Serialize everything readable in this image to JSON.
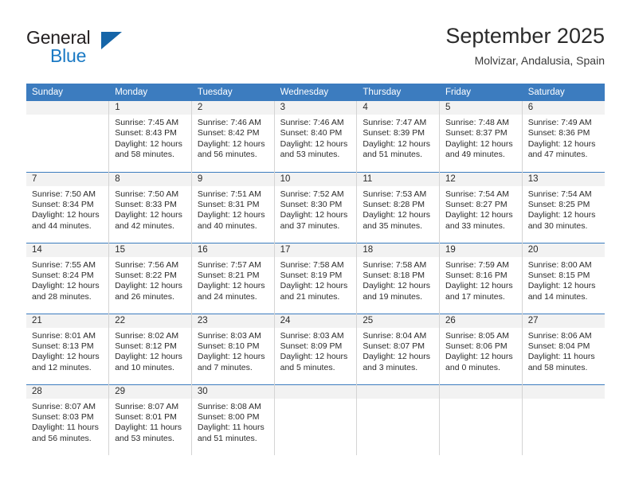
{
  "brand": {
    "name_part1": "General",
    "name_part2": "Blue",
    "logo_icon": "blue-triangle-icon",
    "accent_color": "#1b7ac4"
  },
  "header": {
    "title": "September 2025",
    "subtitle": "Molvizar, Andalusia, Spain"
  },
  "theme": {
    "header_row_color": "#3c7cbf",
    "daynum_band_color": "#f2f2f2",
    "grid_line_color": "#d4d4d4"
  },
  "weekday_headers": [
    "Sunday",
    "Monday",
    "Tuesday",
    "Wednesday",
    "Thursday",
    "Friday",
    "Saturday"
  ],
  "labels": {
    "sunrise_prefix": "Sunrise:",
    "sunset_prefix": "Sunset:",
    "daylight_prefix": "Daylight:"
  },
  "weeks": [
    [
      {
        "day": "",
        "sunrise": "",
        "sunset": "",
        "daylight_line1": "",
        "daylight_line2": ""
      },
      {
        "day": "1",
        "sunrise": "Sunrise: 7:45 AM",
        "sunset": "Sunset: 8:43 PM",
        "daylight_line1": "Daylight: 12 hours",
        "daylight_line2": "and 58 minutes."
      },
      {
        "day": "2",
        "sunrise": "Sunrise: 7:46 AM",
        "sunset": "Sunset: 8:42 PM",
        "daylight_line1": "Daylight: 12 hours",
        "daylight_line2": "and 56 minutes."
      },
      {
        "day": "3",
        "sunrise": "Sunrise: 7:46 AM",
        "sunset": "Sunset: 8:40 PM",
        "daylight_line1": "Daylight: 12 hours",
        "daylight_line2": "and 53 minutes."
      },
      {
        "day": "4",
        "sunrise": "Sunrise: 7:47 AM",
        "sunset": "Sunset: 8:39 PM",
        "daylight_line1": "Daylight: 12 hours",
        "daylight_line2": "and 51 minutes."
      },
      {
        "day": "5",
        "sunrise": "Sunrise: 7:48 AM",
        "sunset": "Sunset: 8:37 PM",
        "daylight_line1": "Daylight: 12 hours",
        "daylight_line2": "and 49 minutes."
      },
      {
        "day": "6",
        "sunrise": "Sunrise: 7:49 AM",
        "sunset": "Sunset: 8:36 PM",
        "daylight_line1": "Daylight: 12 hours",
        "daylight_line2": "and 47 minutes."
      }
    ],
    [
      {
        "day": "7",
        "sunrise": "Sunrise: 7:50 AM",
        "sunset": "Sunset: 8:34 PM",
        "daylight_line1": "Daylight: 12 hours",
        "daylight_line2": "and 44 minutes."
      },
      {
        "day": "8",
        "sunrise": "Sunrise: 7:50 AM",
        "sunset": "Sunset: 8:33 PM",
        "daylight_line1": "Daylight: 12 hours",
        "daylight_line2": "and 42 minutes."
      },
      {
        "day": "9",
        "sunrise": "Sunrise: 7:51 AM",
        "sunset": "Sunset: 8:31 PM",
        "daylight_line1": "Daylight: 12 hours",
        "daylight_line2": "and 40 minutes."
      },
      {
        "day": "10",
        "sunrise": "Sunrise: 7:52 AM",
        "sunset": "Sunset: 8:30 PM",
        "daylight_line1": "Daylight: 12 hours",
        "daylight_line2": "and 37 minutes."
      },
      {
        "day": "11",
        "sunrise": "Sunrise: 7:53 AM",
        "sunset": "Sunset: 8:28 PM",
        "daylight_line1": "Daylight: 12 hours",
        "daylight_line2": "and 35 minutes."
      },
      {
        "day": "12",
        "sunrise": "Sunrise: 7:54 AM",
        "sunset": "Sunset: 8:27 PM",
        "daylight_line1": "Daylight: 12 hours",
        "daylight_line2": "and 33 minutes."
      },
      {
        "day": "13",
        "sunrise": "Sunrise: 7:54 AM",
        "sunset": "Sunset: 8:25 PM",
        "daylight_line1": "Daylight: 12 hours",
        "daylight_line2": "and 30 minutes."
      }
    ],
    [
      {
        "day": "14",
        "sunrise": "Sunrise: 7:55 AM",
        "sunset": "Sunset: 8:24 PM",
        "daylight_line1": "Daylight: 12 hours",
        "daylight_line2": "and 28 minutes."
      },
      {
        "day": "15",
        "sunrise": "Sunrise: 7:56 AM",
        "sunset": "Sunset: 8:22 PM",
        "daylight_line1": "Daylight: 12 hours",
        "daylight_line2": "and 26 minutes."
      },
      {
        "day": "16",
        "sunrise": "Sunrise: 7:57 AM",
        "sunset": "Sunset: 8:21 PM",
        "daylight_line1": "Daylight: 12 hours",
        "daylight_line2": "and 24 minutes."
      },
      {
        "day": "17",
        "sunrise": "Sunrise: 7:58 AM",
        "sunset": "Sunset: 8:19 PM",
        "daylight_line1": "Daylight: 12 hours",
        "daylight_line2": "and 21 minutes."
      },
      {
        "day": "18",
        "sunrise": "Sunrise: 7:58 AM",
        "sunset": "Sunset: 8:18 PM",
        "daylight_line1": "Daylight: 12 hours",
        "daylight_line2": "and 19 minutes."
      },
      {
        "day": "19",
        "sunrise": "Sunrise: 7:59 AM",
        "sunset": "Sunset: 8:16 PM",
        "daylight_line1": "Daylight: 12 hours",
        "daylight_line2": "and 17 minutes."
      },
      {
        "day": "20",
        "sunrise": "Sunrise: 8:00 AM",
        "sunset": "Sunset: 8:15 PM",
        "daylight_line1": "Daylight: 12 hours",
        "daylight_line2": "and 14 minutes."
      }
    ],
    [
      {
        "day": "21",
        "sunrise": "Sunrise: 8:01 AM",
        "sunset": "Sunset: 8:13 PM",
        "daylight_line1": "Daylight: 12 hours",
        "daylight_line2": "and 12 minutes."
      },
      {
        "day": "22",
        "sunrise": "Sunrise: 8:02 AM",
        "sunset": "Sunset: 8:12 PM",
        "daylight_line1": "Daylight: 12 hours",
        "daylight_line2": "and 10 minutes."
      },
      {
        "day": "23",
        "sunrise": "Sunrise: 8:03 AM",
        "sunset": "Sunset: 8:10 PM",
        "daylight_line1": "Daylight: 12 hours",
        "daylight_line2": "and 7 minutes."
      },
      {
        "day": "24",
        "sunrise": "Sunrise: 8:03 AM",
        "sunset": "Sunset: 8:09 PM",
        "daylight_line1": "Daylight: 12 hours",
        "daylight_line2": "and 5 minutes."
      },
      {
        "day": "25",
        "sunrise": "Sunrise: 8:04 AM",
        "sunset": "Sunset: 8:07 PM",
        "daylight_line1": "Daylight: 12 hours",
        "daylight_line2": "and 3 minutes."
      },
      {
        "day": "26",
        "sunrise": "Sunrise: 8:05 AM",
        "sunset": "Sunset: 8:06 PM",
        "daylight_line1": "Daylight: 12 hours",
        "daylight_line2": "and 0 minutes."
      },
      {
        "day": "27",
        "sunrise": "Sunrise: 8:06 AM",
        "sunset": "Sunset: 8:04 PM",
        "daylight_line1": "Daylight: 11 hours",
        "daylight_line2": "and 58 minutes."
      }
    ],
    [
      {
        "day": "28",
        "sunrise": "Sunrise: 8:07 AM",
        "sunset": "Sunset: 8:03 PM",
        "daylight_line1": "Daylight: 11 hours",
        "daylight_line2": "and 56 minutes."
      },
      {
        "day": "29",
        "sunrise": "Sunrise: 8:07 AM",
        "sunset": "Sunset: 8:01 PM",
        "daylight_line1": "Daylight: 11 hours",
        "daylight_line2": "and 53 minutes."
      },
      {
        "day": "30",
        "sunrise": "Sunrise: 8:08 AM",
        "sunset": "Sunset: 8:00 PM",
        "daylight_line1": "Daylight: 11 hours",
        "daylight_line2": "and 51 minutes."
      },
      {
        "day": "",
        "sunrise": "",
        "sunset": "",
        "daylight_line1": "",
        "daylight_line2": ""
      },
      {
        "day": "",
        "sunrise": "",
        "sunset": "",
        "daylight_line1": "",
        "daylight_line2": ""
      },
      {
        "day": "",
        "sunrise": "",
        "sunset": "",
        "daylight_line1": "",
        "daylight_line2": ""
      },
      {
        "day": "",
        "sunrise": "",
        "sunset": "",
        "daylight_line1": "",
        "daylight_line2": ""
      }
    ]
  ]
}
